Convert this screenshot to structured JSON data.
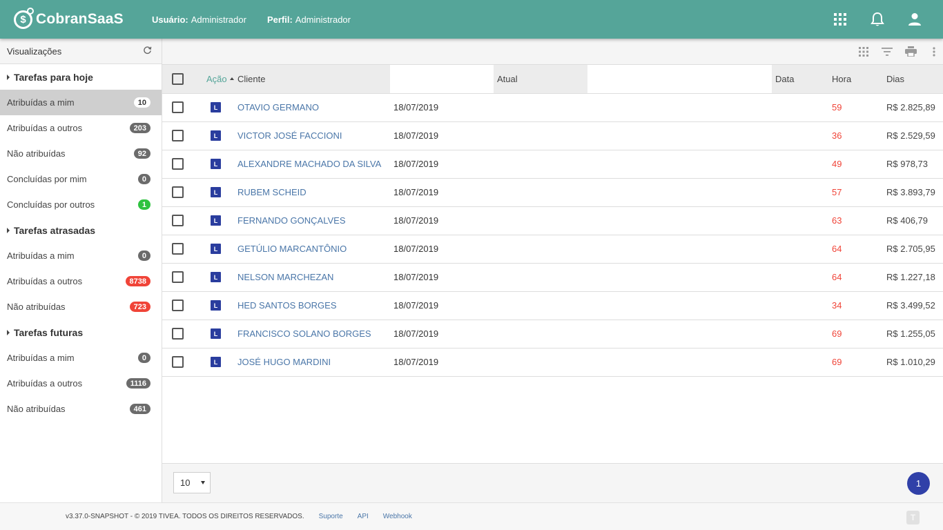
{
  "header": {
    "logo_text": "CobranSaaS",
    "user_label": "Usuário:",
    "user_value": "Administrador",
    "profile_label": "Perfil:",
    "profile_value": "Administrador"
  },
  "sidebar": {
    "title": "Visualizações",
    "groups": [
      {
        "label": "Tarefas para hoje",
        "items": [
          {
            "label": "Atribuídas a mim",
            "count": "10"
          },
          {
            "label": "Atribuídas a outros",
            "count": "203"
          },
          {
            "label": "Não atribuídas",
            "count": "92"
          },
          {
            "label": "Concluídas por mim",
            "count": "0"
          },
          {
            "label": "Concluídas por outros",
            "count": "1"
          }
        ]
      },
      {
        "label": "Tarefas atrasadas",
        "items": [
          {
            "label": "Atribuídas a mim",
            "count": "0"
          },
          {
            "label": "Atribuídas a outros",
            "count": "8738"
          },
          {
            "label": "Não atribuídas",
            "count": "723"
          }
        ]
      },
      {
        "label": "Tarefas futuras",
        "items": [
          {
            "label": "Atribuídas a mim",
            "count": "0"
          },
          {
            "label": "Atribuídas a outros",
            "count": "1116"
          },
          {
            "label": "Não atribuídas",
            "count": "461"
          }
        ]
      }
    ]
  },
  "table": {
    "headers": {
      "acao": "Ação",
      "cliente": "Cliente",
      "atual": "Atual",
      "data": "Data",
      "hora": "Hora",
      "dias": "Dias"
    },
    "action_badge": "L",
    "rows": [
      {
        "cliente": "OTAVIO GERMANO",
        "data": "18/07/2019",
        "dias": "59",
        "valor": "R$ 2.825,89"
      },
      {
        "cliente": "VICTOR JOSÉ FACCIONI",
        "data": "18/07/2019",
        "dias": "36",
        "valor": "R$ 2.529,59"
      },
      {
        "cliente": "ALEXANDRE MACHADO DA SILVA",
        "data": "18/07/2019",
        "dias": "49",
        "valor": "R$ 978,73"
      },
      {
        "cliente": "RUBEM SCHEID",
        "data": "18/07/2019",
        "dias": "57",
        "valor": "R$ 3.893,79"
      },
      {
        "cliente": "FERNANDO GONÇALVES",
        "data": "18/07/2019",
        "dias": "63",
        "valor": "R$ 406,79"
      },
      {
        "cliente": "GETÚLIO MARCANTÔNIO",
        "data": "18/07/2019",
        "dias": "64",
        "valor": "R$ 2.705,95"
      },
      {
        "cliente": "NELSON MARCHEZAN",
        "data": "18/07/2019",
        "dias": "64",
        "valor": "R$ 1.227,18"
      },
      {
        "cliente": "HED SANTOS BORGES",
        "data": "18/07/2019",
        "dias": "34",
        "valor": "R$ 3.499,52"
      },
      {
        "cliente": "FRANCISCO SOLANO BORGES",
        "data": "18/07/2019",
        "dias": "69",
        "valor": "R$ 1.255,05"
      },
      {
        "cliente": "JOSÉ HUGO MARDINI",
        "data": "18/07/2019",
        "dias": "69",
        "valor": "R$ 1.010,29"
      }
    ]
  },
  "pagination": {
    "page_size": "10",
    "current_page": "1"
  },
  "footer": {
    "copyright": "v3.37.0-SNAPSHOT - © 2019 TIVEA. TODOS OS DIREITOS RESERVADOS.",
    "links": [
      "Suporte",
      "API",
      "Webhook"
    ]
  },
  "colors": {
    "header": "#55a599",
    "accent_blue": "#3040a8",
    "badge_red": "#f04438",
    "badge_green": "#2ec23f"
  },
  "icons": [
    "apps-grid-icon",
    "bell-icon",
    "user-icon",
    "refresh-icon",
    "grid-view-icon",
    "filter-icon",
    "print-icon",
    "more-vert-icon"
  ]
}
